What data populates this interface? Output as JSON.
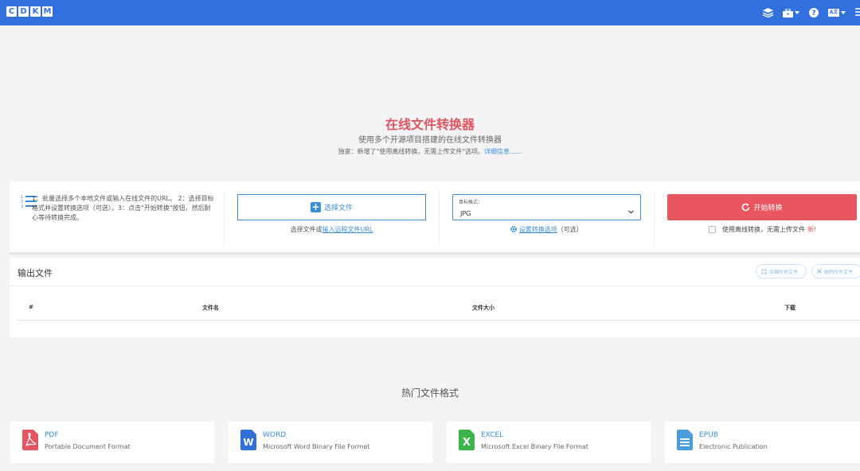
{
  "header": {
    "logo_letters": [
      "C",
      "D",
      "K",
      "M"
    ],
    "icons": [
      "layers-icon",
      "toolbox-icon",
      "help-icon",
      "language-icon",
      "filter-icon"
    ],
    "language_glyph": "A文"
  },
  "hero": {
    "title": "在线文件转换器",
    "subtitle": "使用多个开源项目搭建的在线文件转换器",
    "notice_prefix": "独家：新增了\"使用离线转换，无需上传文件\"选项。",
    "notice_link": "详细信息......"
  },
  "converter": {
    "steps_text": "1：批量选择多个本地文件或输入在线文件的URL。 2：选择目标格式并设置转换选项（可选）。3：点击\"开始转换\"按钮，然后耐心等待转换完成。",
    "select_button": "选择文件",
    "select_hint_prefix": "选择文件或",
    "select_hint_link": "输入远程文件URL",
    "format_label": "目标格式：",
    "format_value": "JPG",
    "settings_link": "设置转换选项",
    "settings_suffix": "（可选）",
    "start_button": "开始转换",
    "offline_label": "使用离线转换，无需上传文件",
    "offline_new": "新!",
    "offline_checked": false
  },
  "output": {
    "title": "输出文件",
    "download_all": "压缩所有文件",
    "delete_all": "删除所有文件",
    "columns": [
      "#",
      "文件名",
      "文件大小",
      "下载"
    ]
  },
  "popular": {
    "title": "热门文件格式",
    "formats": [
      {
        "name": "PDF",
        "desc": "Portable Document Format",
        "color": "#e25561"
      },
      {
        "name": "WORD",
        "desc": "Microsoft Word Binary File Format",
        "color": "#2f6fd6"
      },
      {
        "name": "EXCEL",
        "desc": "Microsoft Excel Binary File Format",
        "color": "#3bb54a"
      },
      {
        "name": "EPUB",
        "desc": "Electronic Publication",
        "color": "#4a9be0"
      }
    ]
  },
  "colors": {
    "header": "#3270de",
    "accent_red": "#e8575f",
    "link_blue": "#3a8cd6"
  }
}
